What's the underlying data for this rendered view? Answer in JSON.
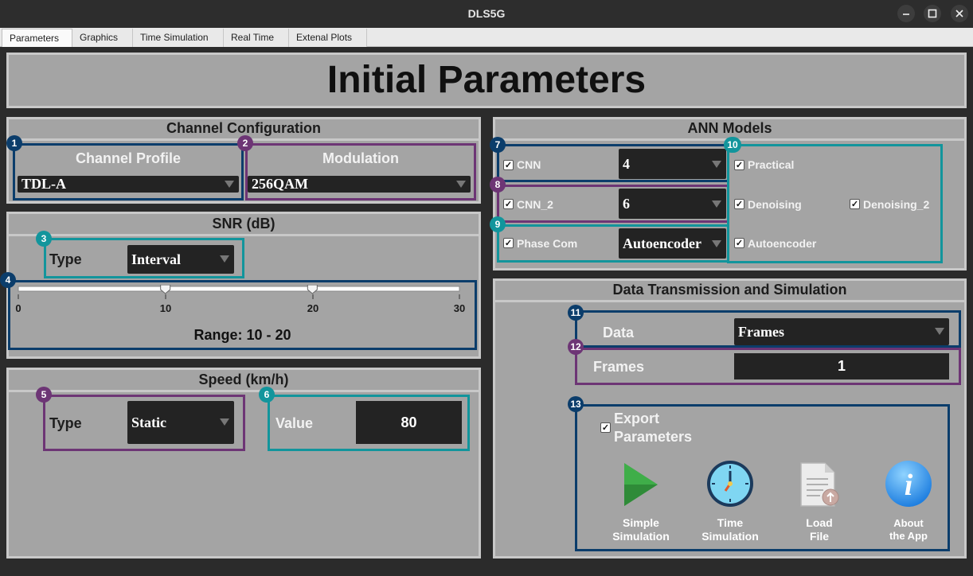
{
  "window": {
    "title": "DLS5G"
  },
  "tabs": [
    "Parameters",
    "Graphics",
    "Time Simulation",
    "Real Time",
    "Extenal Plots"
  ],
  "page_title": "Initial Parameters",
  "channel_config": {
    "heading": "Channel Configuration",
    "profile": {
      "badge": "1",
      "label": "Channel Profile",
      "value": "TDL-A"
    },
    "modulation": {
      "badge": "2",
      "label": "Modulation",
      "value": "256QAM"
    }
  },
  "snr": {
    "heading": "SNR (dB)",
    "type": {
      "badge": "3",
      "label": "Type",
      "value": "Interval"
    },
    "slider": {
      "badge": "4",
      "min": 0,
      "max": 30,
      "low": 10,
      "high": 20,
      "ticks": [
        "0",
        "10",
        "20",
        "30"
      ],
      "range_text": "Range: 10 - 20"
    }
  },
  "speed": {
    "heading": "Speed (km/h)",
    "type": {
      "badge": "5",
      "label": "Type",
      "value": "Static"
    },
    "value": {
      "badge": "6",
      "label": "Value",
      "value": "80"
    }
  },
  "ann": {
    "heading": "ANN Models",
    "rows": [
      {
        "badge": "7",
        "label": "CNN",
        "checked": true,
        "value": "4"
      },
      {
        "badge": "8",
        "label": "CNN_2",
        "checked": true,
        "value": "6"
      },
      {
        "badge": "9",
        "label": "Phase Com",
        "checked": true,
        "value": "Autoencoder"
      }
    ],
    "group": {
      "badge": "10",
      "items": [
        "Practical",
        "Denoising",
        "Denoising_2",
        "Autoencoder"
      ]
    }
  },
  "data_tx": {
    "heading": "Data Transmission and Simulation",
    "data": {
      "badge": "11",
      "label": "Data",
      "value": "Frames"
    },
    "frames": {
      "badge": "12",
      "label": "Frames",
      "value": "1"
    },
    "actions": {
      "badge": "13",
      "export_line1": "Export",
      "export_line2": "Parameters",
      "buttons": [
        {
          "line1": "Simple",
          "line2": "Simulation",
          "icon": "play-icon"
        },
        {
          "line1": "Time",
          "line2": "Simulation",
          "icon": "clock-icon"
        },
        {
          "line1": "Load",
          "line2": "File",
          "icon": "file-upload-icon"
        },
        {
          "line1": "About",
          "line2": "the App",
          "icon": "info-icon"
        }
      ]
    }
  },
  "colors": {
    "blue": "#0b3d6b",
    "purple": "#6d3575",
    "teal": "#12959c"
  }
}
